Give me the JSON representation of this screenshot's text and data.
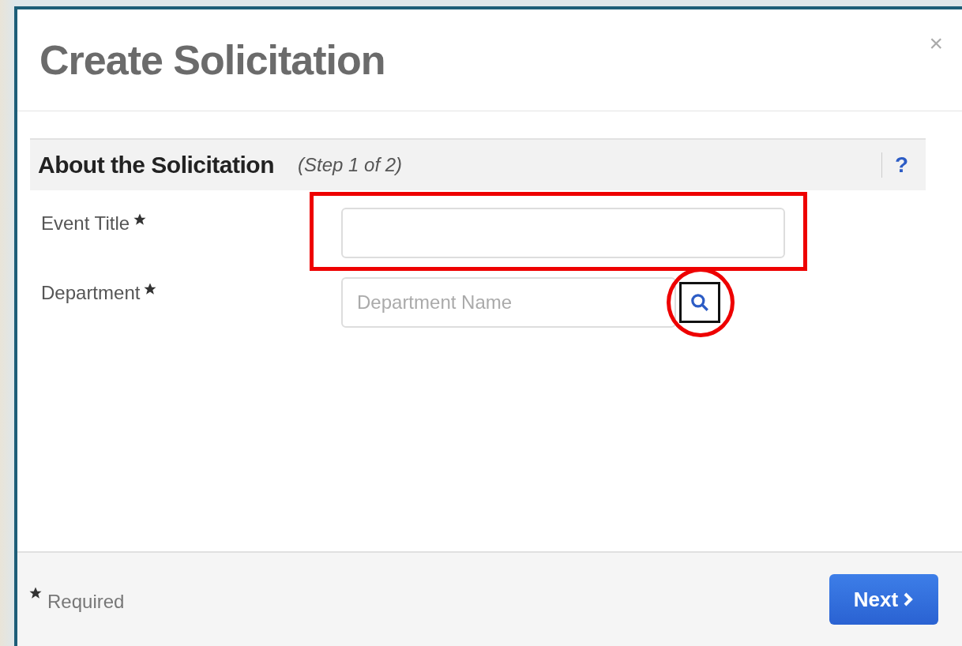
{
  "dialog": {
    "title": "Create Solicitation",
    "close": "×"
  },
  "section": {
    "title": "About the Solicitation",
    "step": "(Step 1 of 2)",
    "help": "?"
  },
  "fields": [
    {
      "kind": "text",
      "label": "Event Title",
      "required": true,
      "highlighted": true
    },
    {
      "kind": "lookup",
      "label": "Department",
      "required": true,
      "placeholder": "Department Name",
      "highlighted": true
    }
  ],
  "footer": {
    "legend": "Required",
    "button": "Next"
  }
}
